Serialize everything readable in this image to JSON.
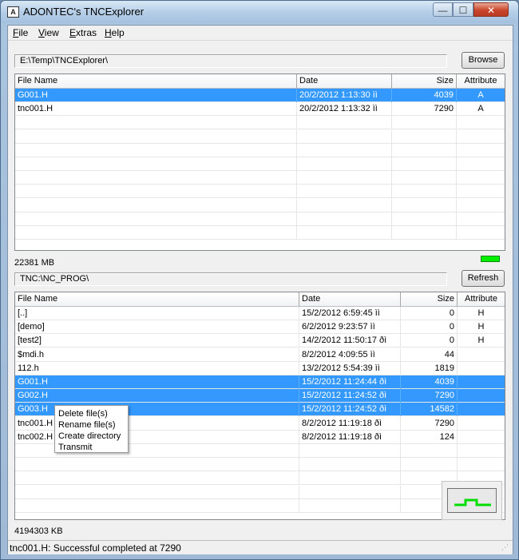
{
  "window": {
    "title": "ADONTEC's  TNCExplorer",
    "app_icon_text": "A",
    "controls": {
      "minimize": "—",
      "maximize": "☐",
      "close": "✕"
    }
  },
  "menu": [
    "File",
    "View",
    "Extras",
    "Help"
  ],
  "local": {
    "path": "E:\\Temp\\TNCExplorer\\",
    "browse_label": "Browse",
    "columns": [
      "File Name",
      "Date",
      "Size",
      "Attribute"
    ],
    "rows": [
      {
        "name": "G001.H",
        "date": "20/2/2012 1:13:30 ìì",
        "size": "4039",
        "attr": "A",
        "selected": true
      },
      {
        "name": "tnc001.H",
        "date": "20/2/2012 1:13:32 ìì",
        "size": "7290",
        "attr": "A",
        "selected": false
      }
    ],
    "free_space": "22381 MB",
    "indicator_color": "#00ee00"
  },
  "tnc": {
    "path": "TNC:\\NC_PROG\\",
    "refresh_label": "Refresh",
    "columns": [
      "File Name",
      "Date",
      "Size",
      "Attribute"
    ],
    "rows": [
      {
        "name": "[..]",
        "date": "15/2/2012 6:59:45 ìì",
        "size": "0",
        "attr": "H",
        "selected": false
      },
      {
        "name": "[demo]",
        "date": "6/2/2012 9:23:57 ìì",
        "size": "0",
        "attr": "H",
        "selected": false
      },
      {
        "name": "[test2]",
        "date": "14/2/2012 11:50:17 ðì",
        "size": "0",
        "attr": "H",
        "selected": false
      },
      {
        "name": "$mdi.h",
        "date": "8/2/2012 4:09:55 ìì",
        "size": "44",
        "attr": "",
        "selected": false
      },
      {
        "name": "112.h",
        "date": "13/2/2012 5:54:39 ìì",
        "size": "1819",
        "attr": "",
        "selected": false
      },
      {
        "name": "G001.H",
        "date": "15/2/2012 11:24:44 ðì",
        "size": "4039",
        "attr": "",
        "selected": true
      },
      {
        "name": "G002.H",
        "date": "15/2/2012 11:24:52 ðì",
        "size": "7290",
        "attr": "",
        "selected": true
      },
      {
        "name": "G003.H",
        "date": "15/2/2012 11:24:52 ðì",
        "size": "14582",
        "attr": "",
        "selected": true
      },
      {
        "name": "tnc001.H",
        "date": "8/2/2012 11:19:18 ðì",
        "size": "7290",
        "attr": "",
        "selected": false
      },
      {
        "name": "tnc002.H",
        "date": "8/2/2012 11:19:18 ðì",
        "size": "124",
        "attr": "",
        "selected": false
      }
    ],
    "free_space": "4194303 KB"
  },
  "context_menu": [
    "Delete file(s)",
    "Rename file(s)",
    "Create directory",
    "Transmit"
  ],
  "status": "tnc001.H: Successful completed at 7290",
  "colors": {
    "selection": "#3399ff",
    "signal": "#00dd00"
  }
}
